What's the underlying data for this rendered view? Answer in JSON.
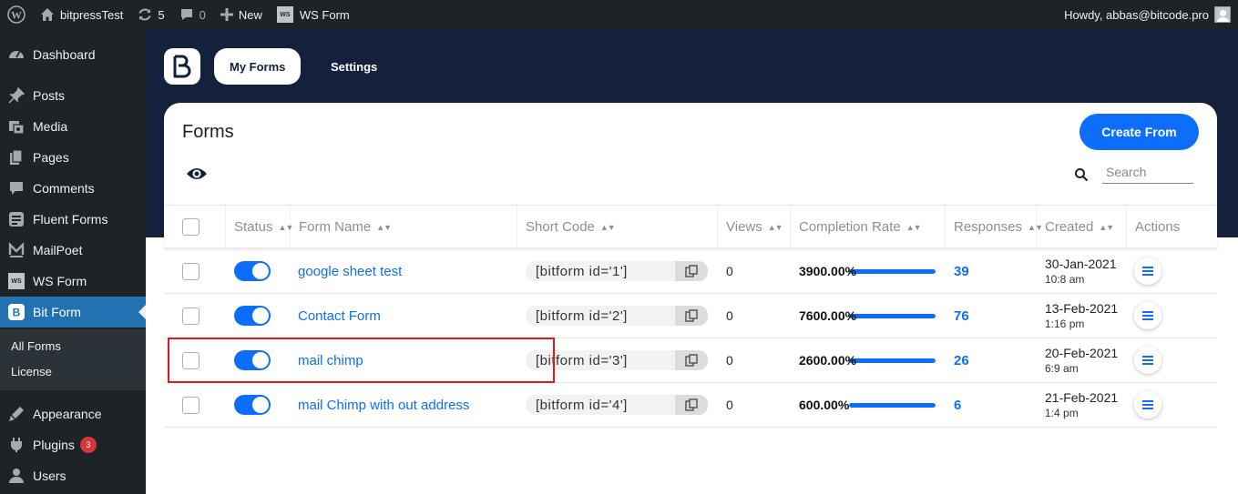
{
  "admin_bar": {
    "site_name": "bitpressTest",
    "updates_count": "5",
    "comments_count": "0",
    "new_label": "New",
    "ws_form_label": "WS Form",
    "ws_badge": "WS",
    "greeting": "Howdy, abbas@bitcode.pro"
  },
  "sidebar": {
    "items": [
      {
        "label": "Dashboard",
        "icon": "dashboard-icon"
      },
      {
        "label": "Posts",
        "icon": "pin-icon"
      },
      {
        "label": "Media",
        "icon": "media-icon"
      },
      {
        "label": "Pages",
        "icon": "pages-icon"
      },
      {
        "label": "Comments",
        "icon": "comments-icon"
      },
      {
        "label": "Fluent Forms",
        "icon": "fluent-forms-icon"
      },
      {
        "label": "MailPoet",
        "icon": "mailpoet-icon"
      },
      {
        "label": "WS Form",
        "icon": "ws-form-icon"
      },
      {
        "label": "Bit Form",
        "icon": "bit-form-icon"
      },
      {
        "label": "Appearance",
        "icon": "appearance-icon"
      },
      {
        "label": "Plugins",
        "icon": "plugins-icon"
      },
      {
        "label": "Users",
        "icon": "users-icon"
      }
    ],
    "submenu": [
      "All Forms",
      "License"
    ],
    "plugins_badge": "3"
  },
  "tabs": {
    "my_forms": "My Forms",
    "settings": "Settings"
  },
  "card": {
    "title": "Forms",
    "create_button": "Create From",
    "search_placeholder": "Search"
  },
  "table": {
    "columns": [
      "Status",
      "Form Name",
      "Short Code",
      "Views",
      "Completion Rate",
      "Responses",
      "Created",
      "Actions"
    ],
    "rows": [
      {
        "name": "google sheet test",
        "shortcode": "[bitform id='1']",
        "views": "0",
        "rate": "3900.00%",
        "rate_fill": 1.0,
        "responses": "39",
        "date": "30-Jan-2021",
        "time": "10:8 am",
        "status_on": true
      },
      {
        "name": "Contact Form",
        "shortcode": "[bitform id='2']",
        "views": "0",
        "rate": "7600.00%",
        "rate_fill": 1.0,
        "responses": "76",
        "date": "13-Feb-2021",
        "time": "1:16 pm",
        "status_on": true
      },
      {
        "name": "mail chimp",
        "shortcode": "[bitform id='3']",
        "views": "0",
        "rate": "2600.00%",
        "rate_fill": 1.0,
        "responses": "26",
        "date": "20-Feb-2021",
        "time": "6:9 am",
        "status_on": true
      },
      {
        "name": "mail Chimp with out address",
        "shortcode": "[bitform id='4']",
        "views": "0",
        "rate": "600.00%",
        "rate_fill": 1.0,
        "responses": "6",
        "date": "21-Feb-2021",
        "time": "1:4 pm",
        "status_on": true
      }
    ]
  },
  "colors": {
    "accent": "#0d6efd",
    "navy": "#14213d",
    "wp_dark": "#1d2327",
    "wp_blue": "#2271b1",
    "highlight_red": "#e0191b"
  }
}
